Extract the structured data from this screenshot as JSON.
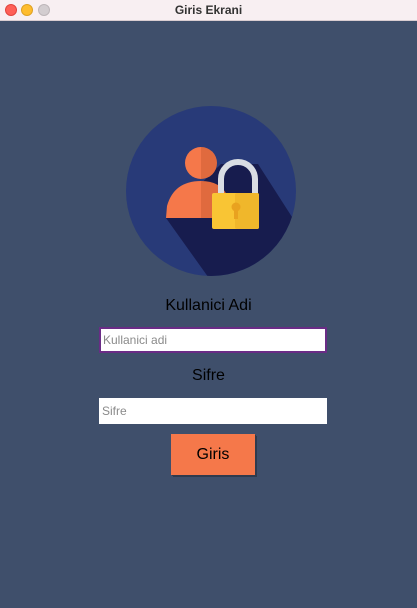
{
  "window": {
    "title": "Giris Ekrani"
  },
  "form": {
    "username_label": "Kullanici Adi",
    "username_placeholder": "Kullanici adi",
    "username_value": "",
    "password_label": "Sifre",
    "password_placeholder": "Sifre",
    "password_value": "",
    "login_button": "Giris"
  },
  "icons": {
    "logo": "user-lock-icon"
  },
  "colors": {
    "background": "#3f4f6b",
    "logo_circle": "#283a78",
    "logo_shadow": "#171c4e",
    "user_orange": "#f5784a",
    "lock_yellow": "#f9c534",
    "button": "#f5784a",
    "focus_border": "#6a2c86"
  }
}
